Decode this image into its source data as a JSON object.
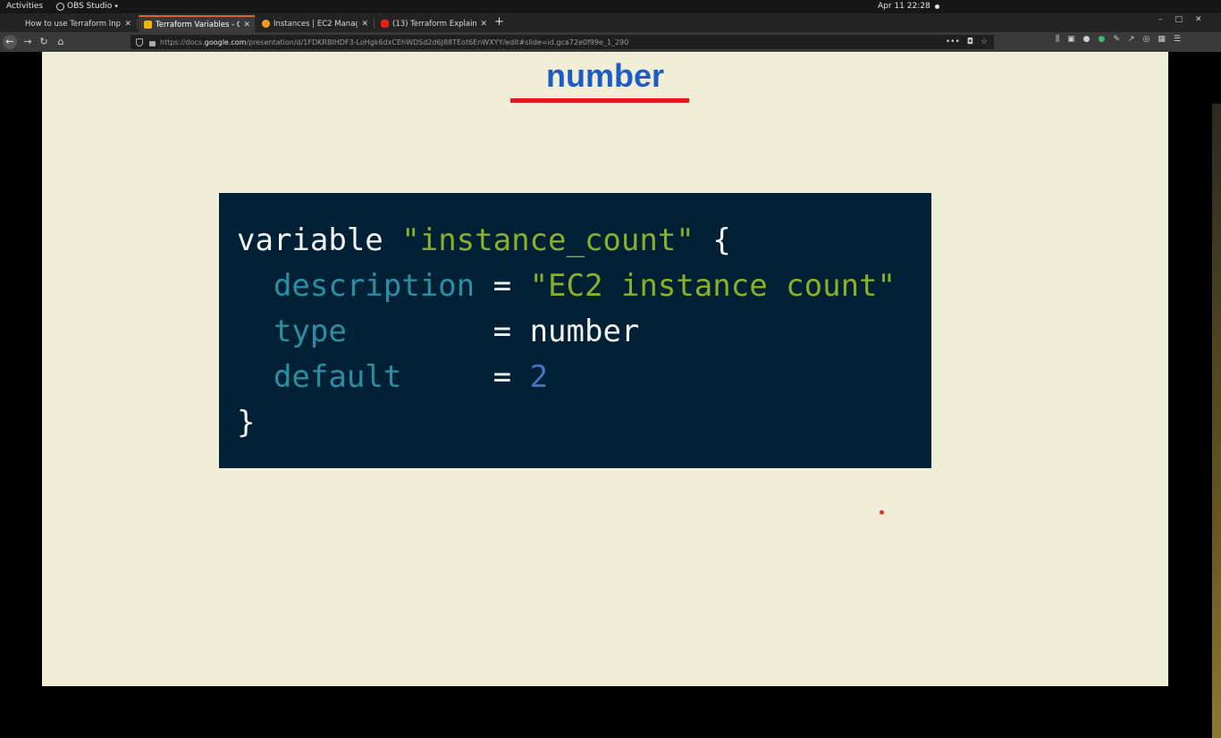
{
  "topbar": {
    "activities": "Activities",
    "app_name": "OBS Studio",
    "clock": "Apr 11  22:28"
  },
  "tabs": [
    {
      "label": "How to use Terraform Inpu",
      "favicon_color": "#888888",
      "active": false
    },
    {
      "label": "Terraform Variables - Go",
      "favicon_color": "#f4b400",
      "active": true
    },
    {
      "label": "Instances | EC2 Manage",
      "favicon_color": "#f59b22",
      "active": false
    },
    {
      "label": "(13) Terraform Explaine",
      "favicon_color": "#e62117",
      "active": false
    }
  ],
  "navbar": {
    "url_prefix": "https://docs.",
    "url_host": "google.com",
    "url_rest": "/presentation/d/1FDKRBIHDF3-LoHgk6dxCEhWDSd2d6J88TEot6EnWXYY/edit#slide=id.gca72e0f99e_1_290"
  },
  "slide": {
    "title": "number",
    "code": {
      "line1": {
        "kw": "variable",
        "str": "\"instance_count\"",
        "brace": "{"
      },
      "line2": {
        "attr": "description",
        "op": "=",
        "str": "\"EC2 instance count\""
      },
      "line3": {
        "attr": "type",
        "op": "=",
        "val": "number"
      },
      "line4": {
        "attr": "default",
        "op": "=",
        "num": "2"
      },
      "line5": {
        "brace": "}"
      }
    }
  },
  "colors": {
    "slide_bg": "#f0eed7",
    "title": "#1d5cc4",
    "underline": "#d91c1c",
    "code_bg": "#002036",
    "code_string": "#8ab028",
    "code_attr": "#2b8ea3",
    "code_number": "#4573bf"
  }
}
